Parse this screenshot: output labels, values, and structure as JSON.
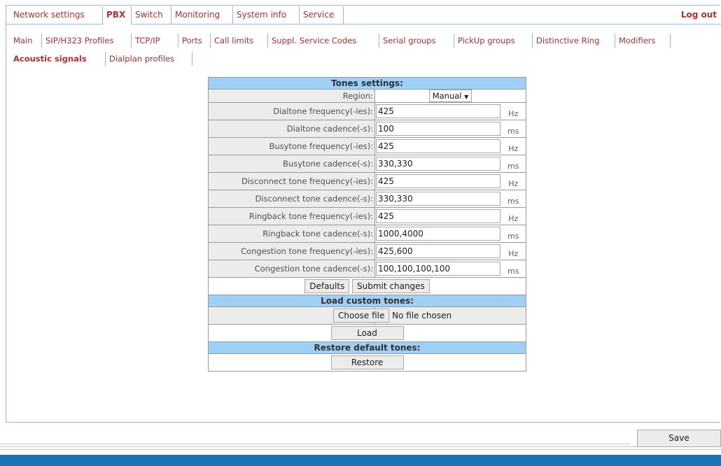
{
  "top_nav": {
    "items": [
      "Network settings",
      "PBX",
      "Switch",
      "Monitoring",
      "System info",
      "Service"
    ],
    "active": "PBX",
    "logout_label": "Log out"
  },
  "sub_nav": {
    "row1": [
      "Main",
      "SIP/H323 Profiles",
      "TCP/IP",
      "Ports",
      "Call limits",
      "Suppl. Service Codes",
      "Serial groups",
      "PickUp groups",
      "Distinctive Ring",
      "Modifiers"
    ],
    "row2": [
      "Acoustic signals",
      "Dialplan profiles"
    ],
    "active": "Acoustic signals"
  },
  "tones": {
    "header": "Tones settings:",
    "region_label": "Region:",
    "region_value": "Manual",
    "select_arrow": "▼",
    "rows": [
      {
        "label": "Dialtone frequency(-ies):",
        "value": "425",
        "unit": "Hz"
      },
      {
        "label": "Dialtone cadence(-s):",
        "value": "100",
        "unit": "ms"
      },
      {
        "label": "Busytone frequency(-ies):",
        "value": "425",
        "unit": "Hz"
      },
      {
        "label": "Busytone cadence(-s):",
        "value": "330,330",
        "unit": "ms"
      },
      {
        "label": "Disconnect tone frequency(-ies):",
        "value": "425",
        "unit": "Hz"
      },
      {
        "label": "Disconnect tone cadence(-s):",
        "value": "330,330",
        "unit": "ms"
      },
      {
        "label": "Ringback tone frequency(-ies):",
        "value": "425",
        "unit": "Hz"
      },
      {
        "label": "Ringback tone cadence(-s):",
        "value": "1000,4000",
        "unit": "ms"
      },
      {
        "label": "Congestion tone frequency(-ies):",
        "value": "425,600",
        "unit": "Hz"
      },
      {
        "label": "Congestion tone cadence(-s):",
        "value": "100,100,100,100",
        "unit": "ms"
      }
    ],
    "defaults_label": "Defaults",
    "submit_label": "Submit changes"
  },
  "custom_tones": {
    "header": "Load custom tones:",
    "choose_file_label": "Choose file",
    "no_file_text": "No file chosen",
    "load_label": "Load"
  },
  "restore": {
    "header": "Restore default tones:",
    "restore_label": "Restore"
  },
  "save_label": "Save",
  "colors": {
    "link": "#b23030",
    "header_bg": "#9ed0f5",
    "footer_bar": "#1a73b8"
  }
}
